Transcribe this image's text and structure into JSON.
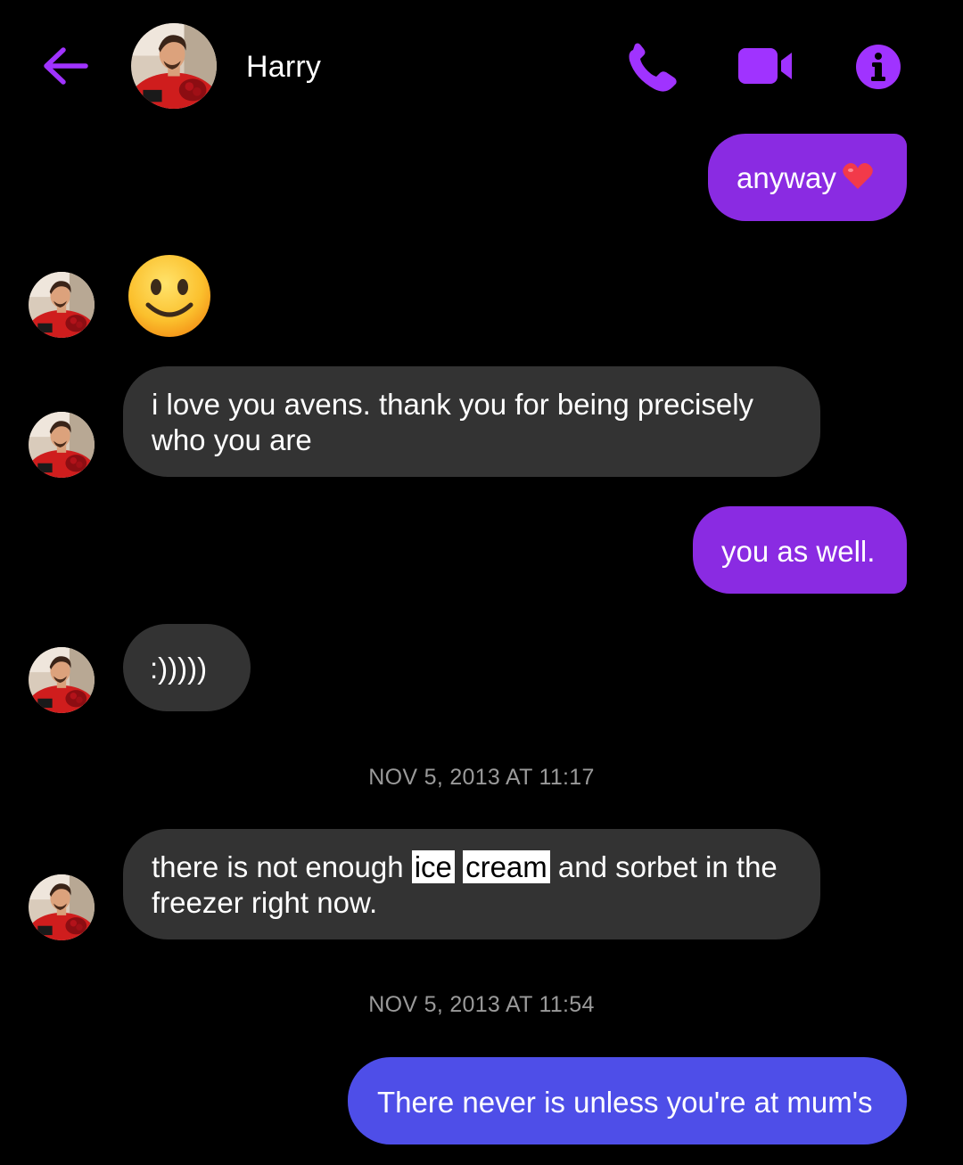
{
  "colors": {
    "accent": "#a033ff",
    "outgoing_bubble": "#8a2be2",
    "outgoing_bubble_latest": "#4e4ee8",
    "incoming_bubble": "#333333",
    "background": "#000000",
    "timestamp": "#9a9a9a"
  },
  "header": {
    "contact_name": "Harry",
    "icons": [
      "back-arrow-icon",
      "phone-icon",
      "video-camera-icon",
      "info-icon"
    ]
  },
  "messages": {
    "m1": {
      "text": "anyway",
      "emoji": "red-heart"
    },
    "m2": {
      "emoji": "slightly-smiling-face"
    },
    "m3": {
      "text": "i love you avens. thank you for being precisely who you are"
    },
    "m4": {
      "text": "you as well."
    },
    "m5": {
      "text": ":)))))"
    },
    "m6": {
      "text_before": "there is not enough ",
      "highlight_1": "ice",
      "highlight_2": "cream",
      "text_after": " and sorbet in the freezer right now."
    },
    "m7": {
      "text": "There never is unless you're at mum's"
    }
  },
  "timestamps": {
    "t1": "NOV 5, 2013 AT 11:17",
    "t2": "NOV 5, 2013 AT 11:54"
  }
}
